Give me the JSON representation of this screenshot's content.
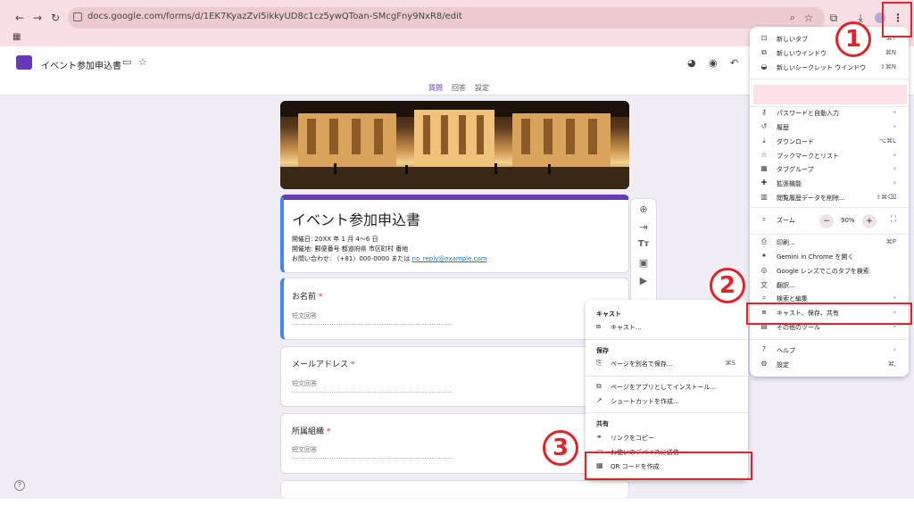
{
  "browser": {
    "url": "docs.google.com/forms/d/1EK7KyazZvI5ikkyUD8c1cz5ywQToan-SMcgFny9NxR8/edit"
  },
  "app": {
    "title": "イベント参加申込書",
    "tabs": [
      "質問",
      "回答",
      "設定"
    ],
    "active_tab": "質問"
  },
  "form": {
    "title": "イベント参加申込書",
    "description_lines": [
      "開催日: 20XX 年 1 月 4〜6 日",
      "開催地: 郵便番号 都道府県 市区町村 番地"
    ],
    "contact_prefix": "お問い合わせ: （+81）000-0000 または ",
    "contact_email": "no_reply@example.com",
    "questions": [
      {
        "label": "お名前",
        "required": "*",
        "placeholder": "短文回答"
      },
      {
        "label": "メールアドレス",
        "required": "*",
        "placeholder": "短文回答"
      },
      {
        "label": "所属組織",
        "required": "*",
        "placeholder": "短文回答"
      }
    ]
  },
  "chrome_menu": {
    "items": [
      {
        "icon": "new-tab-icon",
        "glyph": "⊡",
        "label": "新しいタブ",
        "shortcut": "⌘T"
      },
      {
        "icon": "new-window-icon",
        "glyph": "⧉",
        "label": "新しいウインドウ",
        "shortcut": "⌘N"
      },
      {
        "icon": "incognito-icon",
        "glyph": "◒",
        "label": "新しいシークレット ウインドウ",
        "shortcut": "⇧⌘N"
      },
      {
        "icon": "key-icon",
        "glyph": "⚷",
        "label": "パスワードと自動入力",
        "arrow": "›"
      },
      {
        "icon": "history-icon",
        "glyph": "↺",
        "label": "履歴",
        "arrow": "›"
      },
      {
        "icon": "download-icon",
        "glyph": "⤓",
        "label": "ダウンロード",
        "shortcut": "⌥⌘L"
      },
      {
        "icon": "star-icon",
        "glyph": "☆",
        "label": "ブックマークとリスト",
        "arrow": "›"
      },
      {
        "icon": "tab-groups-icon",
        "glyph": "▦",
        "label": "タブグループ",
        "arrow": "›"
      },
      {
        "icon": "extensions-icon",
        "glyph": "✚",
        "label": "拡張機能",
        "arrow": "›"
      },
      {
        "icon": "trash-icon",
        "glyph": "▥",
        "label": "閲覧履歴データを削除...",
        "shortcut": "⇧⌘⌫"
      },
      {
        "icon": "print-icon",
        "glyph": "⎙",
        "label": "印刷...",
        "shortcut": "⌘P"
      },
      {
        "icon": "gemini-icon",
        "glyph": "✦",
        "label": "Gemini in Chrome を開く"
      },
      {
        "icon": "lens-icon",
        "glyph": "◎",
        "label": "Google レンズでこのタブを検索"
      },
      {
        "icon": "translate-icon",
        "glyph": "文",
        "label": "翻訳..."
      },
      {
        "icon": "find-icon",
        "glyph": "⌕",
        "label": "検索と編集",
        "arrow": "›"
      },
      {
        "icon": "cast-icon",
        "glyph": "⧈",
        "label": "キャスト、保存、共有",
        "arrow": "›"
      },
      {
        "icon": "tools-icon",
        "glyph": "▤",
        "label": "その他のツール",
        "arrow": "›"
      },
      {
        "icon": "help-icon",
        "glyph": "?",
        "label": "ヘルプ",
        "arrow": "›"
      },
      {
        "icon": "settings-icon",
        "glyph": "⚙",
        "label": "設定",
        "shortcut": "⌘,"
      }
    ],
    "zoom_label": "ズーム",
    "zoom_value": "90%",
    "zoom_minus": "−",
    "zoom_plus": "+"
  },
  "submenu": {
    "cast_header": "キャスト",
    "cast_item": "キャスト...",
    "save_header": "保存",
    "save_page": "ページを別名で保存...",
    "save_page_shortcut": "⌘S",
    "install_app": "ページをアプリとしてインストール...",
    "create_shortcut": "ショートカットを作成...",
    "share_header": "共有",
    "copy_link": "リンクをコピー",
    "send_devices": "お使いのデバイスに送信",
    "qr_code": "QR コードを作成"
  },
  "callouts": [
    "1",
    "2",
    "3"
  ],
  "colors": {
    "accent": "#673ab7",
    "highlight": "#e0242c",
    "chrome_bg": "#f9dfe4"
  }
}
